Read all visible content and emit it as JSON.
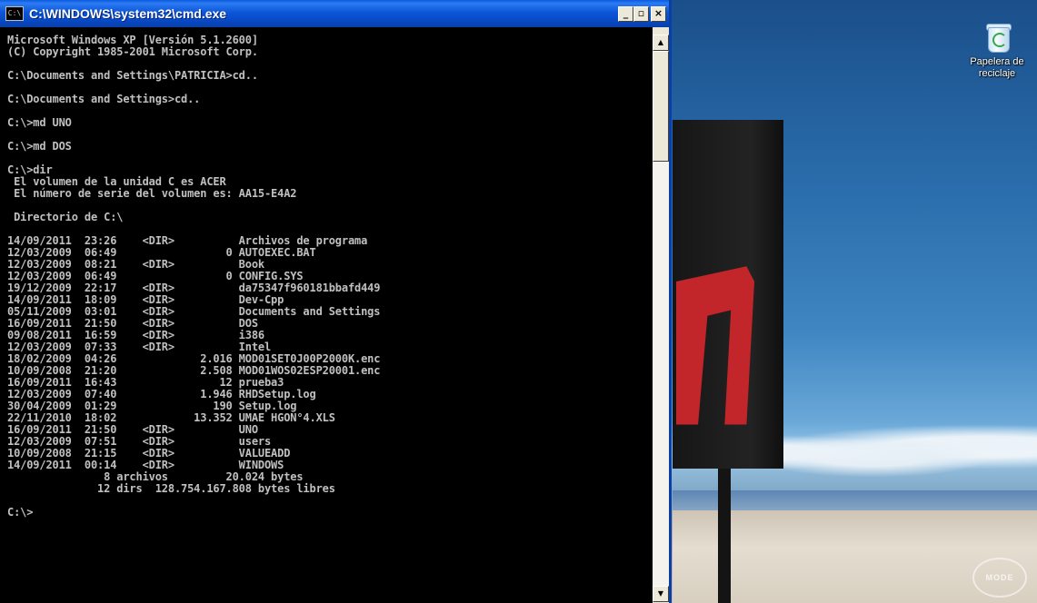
{
  "window": {
    "title": "C:\\WINDOWS\\system32\\cmd.exe",
    "icon_text": "C:\\",
    "buttons": {
      "minimize": "_",
      "maximize": "▫",
      "close": "×"
    }
  },
  "console": {
    "lines": [
      "Microsoft Windows XP [Versión 5.1.2600]",
      "(C) Copyright 1985-2001 Microsoft Corp.",
      "",
      "C:\\Documents and Settings\\PATRICIA>cd..",
      "",
      "C:\\Documents and Settings>cd..",
      "",
      "C:\\>md UNO",
      "",
      "C:\\>md DOS",
      "",
      "C:\\>dir",
      " El volumen de la unidad C es ACER",
      " El número de serie del volumen es: AA15-E4A2",
      "",
      " Directorio de C:\\",
      "",
      "14/09/2011  23:26    <DIR>          Archivos de programa",
      "12/03/2009  06:49                 0 AUTOEXEC.BAT",
      "12/03/2009  08:21    <DIR>          Book",
      "12/03/2009  06:49                 0 CONFIG.SYS",
      "19/12/2009  22:17    <DIR>          da75347f960181bbafd449",
      "14/09/2011  18:09    <DIR>          Dev-Cpp",
      "05/11/2009  03:01    <DIR>          Documents and Settings",
      "16/09/2011  21:50    <DIR>          DOS",
      "09/08/2011  16:59    <DIR>          i386",
      "12/03/2009  07:33    <DIR>          Intel",
      "18/02/2009  04:26             2.016 MOD01SET0J00P2000K.enc",
      "10/09/2008  21:20             2.508 MOD01WOS02ESP20001.enc",
      "16/09/2011  16:43                12 prueba3",
      "12/03/2009  07:40             1.946 RHDSetup.log",
      "30/04/2009  01:29               190 Setup.log",
      "22/11/2010  18:02            13.352 UMAE HGON°4.XLS",
      "16/09/2011  21:50    <DIR>          UNO",
      "12/03/2009  07:51    <DIR>          users",
      "10/09/2008  21:15    <DIR>          VALUEADD",
      "14/09/2011  00:14    <DIR>          WINDOWS",
      "               8 archivos         20.024 bytes",
      "              12 dirs  128.754.167.808 bytes libres",
      "",
      "C:\\>"
    ]
  },
  "scrollbar": {
    "up_arrow": "▲",
    "down_arrow": "▼"
  },
  "desktop": {
    "recycle_bin_label": "Papelera de reciclaje",
    "watermark_text": "MODE"
  },
  "colors": {
    "titlebar": "#0c56d8",
    "console_bg": "#000000",
    "console_fg": "#c0c0c0"
  }
}
